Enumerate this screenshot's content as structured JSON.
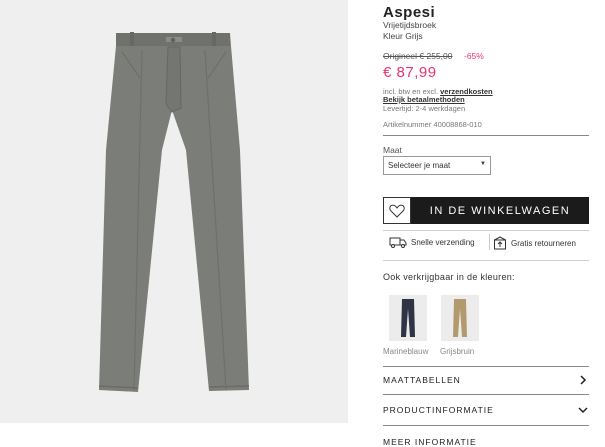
{
  "product": {
    "brand": "Aspesi",
    "subtitle": "Vrijetijdsbroek",
    "color": "Kleur Grijs"
  },
  "pricing": {
    "original": "Origineel € 255,00",
    "discount": "-65%",
    "price": "€ 87,99",
    "tax_prefix": "incl. btw en excl.",
    "shipping_link": "verzendkosten",
    "payment_link": "Bekijk betaalmethoden",
    "delivery": "Levertijd: 2-4 werkdagen"
  },
  "article_number": "Artikelnummer 40008868-010",
  "size": {
    "label": "Maat",
    "placeholder": "Selecteer je maat"
  },
  "cart_button": "IN DE WINKELWAGEN",
  "usps": {
    "shipping": "Snelle verzending",
    "returns": "Gratis retourneren"
  },
  "variants": {
    "heading": "Ook verkrijgbaar in de kleuren:",
    "items": [
      {
        "label": "Marineblauw",
        "color": "#2f3444"
      },
      {
        "label": "Grijsbruin",
        "color": "#b39a6e"
      }
    ]
  },
  "accordion": {
    "size_tables": "MAATTABELLEN",
    "product_info": "PRODUCTINFORMATIE",
    "more_info": "MEER INFORMATIE"
  },
  "colors": {
    "accent": "#e8336d",
    "button": "#1b1b1b",
    "trousers": "#7b7d79"
  },
  "icons": [
    "heart-icon",
    "truck-icon",
    "return-box-icon",
    "chevron-right-icon",
    "chevron-down-icon",
    "caret-down-icon"
  ]
}
